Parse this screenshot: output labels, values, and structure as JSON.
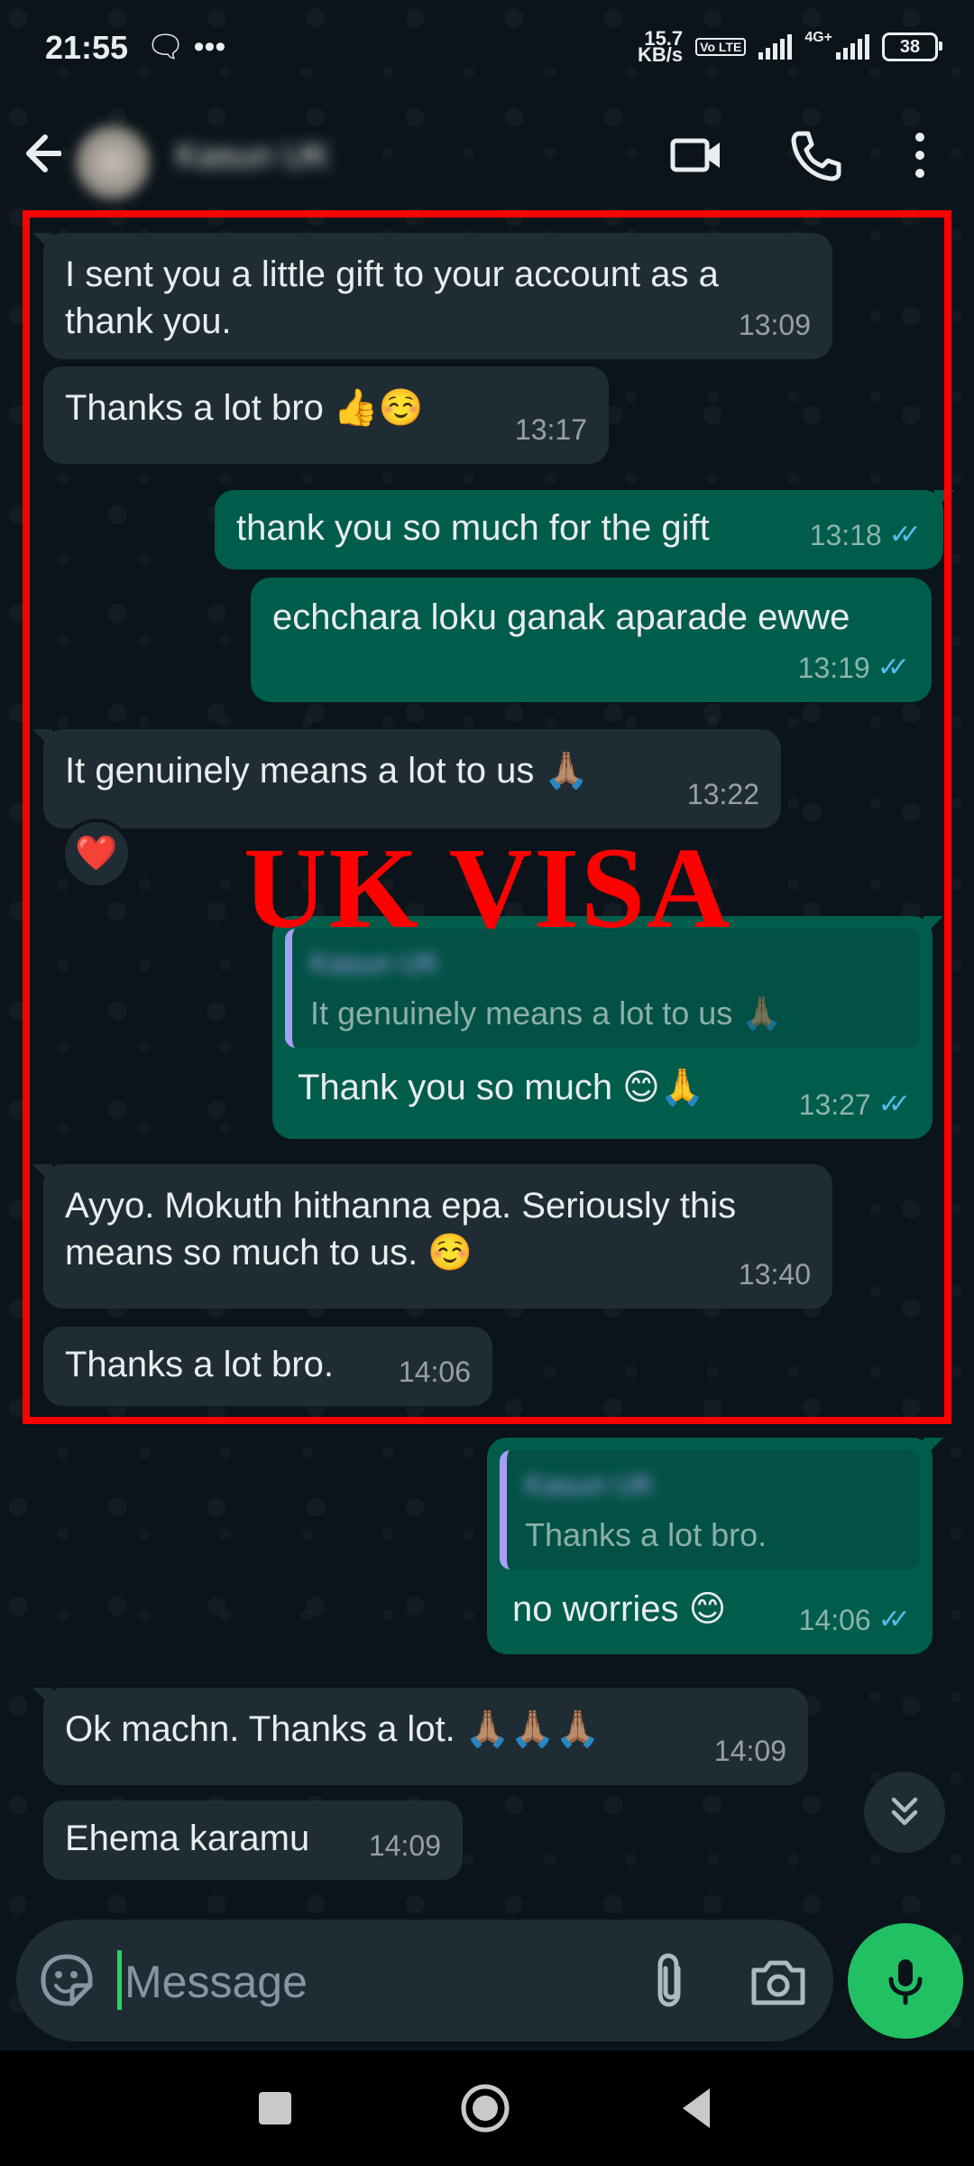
{
  "status_bar": {
    "time": "21:55",
    "icons_left": "🗨 •••",
    "net_speed_value": "15.7",
    "net_speed_unit": "KB/s",
    "volte": "Vo LTE",
    "network": "4G+",
    "battery": "38"
  },
  "header": {
    "contact_name": "Kasun UK",
    "icons": [
      "back-arrow-icon",
      "video-call-icon",
      "voice-call-icon",
      "more-options-icon"
    ]
  },
  "messages": [
    {
      "dir": "in",
      "text": "I sent you a little gift to your account as a thank you.",
      "time": "13:09"
    },
    {
      "dir": "in",
      "text": "Thanks a lot bro 👍☺️",
      "time": "13:17"
    },
    {
      "dir": "out",
      "text": "thank you so much for the gift",
      "time": "13:18"
    },
    {
      "dir": "out",
      "text": "echchara loku ganak aparade ewwe",
      "time": "13:19"
    },
    {
      "dir": "in",
      "text": "It genuinely means a lot to us 🙏🏽",
      "time": "13:22",
      "reaction": "❤️"
    },
    {
      "dir": "out",
      "quote_name": "Kasun UK",
      "quote_text": "It genuinely means a lot to us 🙏🏽",
      "text": "Thank you so much 😊🙏",
      "time": "13:27"
    },
    {
      "dir": "in",
      "text": "Ayyo. Mokuth hithanna epa. Seriously this means so much to us. ☺️",
      "time": "13:40"
    },
    {
      "dir": "in",
      "text": "Thanks a lot bro.",
      "time": "14:06"
    },
    {
      "dir": "out",
      "quote_name": "Kasun UK",
      "quote_text": "Thanks a lot bro.",
      "text": "no worries 😊",
      "time": "14:06"
    },
    {
      "dir": "in",
      "text": "Ok machn. Thanks a lot. 🙏🏽🙏🏽🙏🏽",
      "time": "14:09"
    },
    {
      "dir": "in",
      "text": "Ehema karamu",
      "time": "14:09"
    }
  ],
  "overlay_text": "UK VISA",
  "composer": {
    "placeholder": "Message"
  },
  "colors": {
    "background": "#0b141a",
    "incoming_bubble": "#202c33",
    "outgoing_bubble": "#005c4b",
    "read_ticks": "#53bdeb",
    "mic_button": "#21c063",
    "highlight_box": "#ff0000"
  }
}
